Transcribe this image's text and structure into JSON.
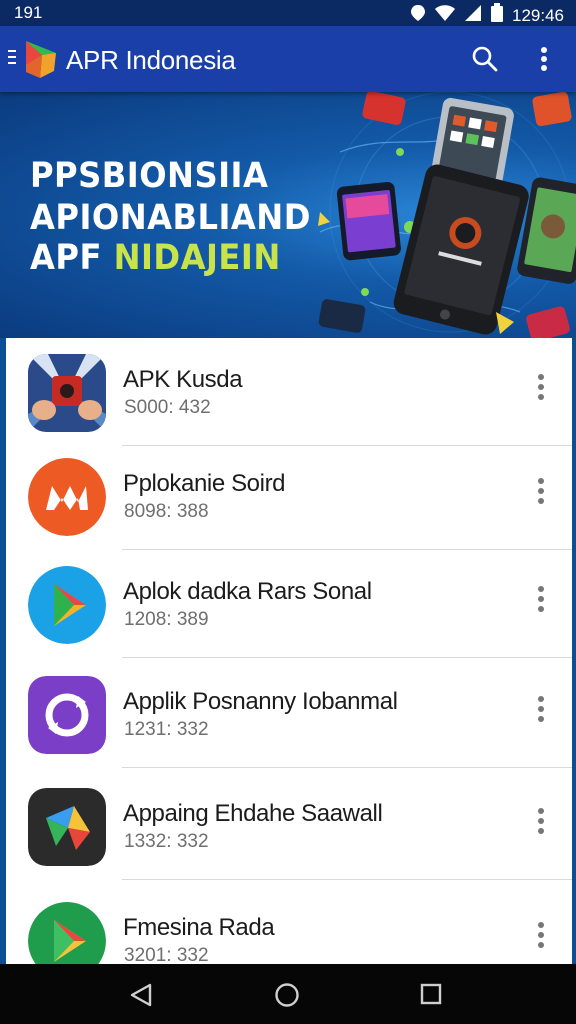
{
  "status_bar": {
    "left_time": "191",
    "right_time": "129:46",
    "icons": [
      "wifi-icon",
      "signal-icon",
      "battery-icon"
    ]
  },
  "app_bar": {
    "title": "APR Indonesia",
    "icons": [
      "menu-icon",
      "app-logo",
      "search-icon",
      "overflow-menu-icon"
    ],
    "background_color": "#1a3fa8"
  },
  "banner": {
    "line1": "PPSBIONSIIA",
    "line2": "APIONABLIAND",
    "line3_prefix": "APF ",
    "line3_accent": "NIDAJEIN",
    "accent_color": "#c9e34a"
  },
  "apps": [
    {
      "name": "APK Kusda",
      "meta": "S000: 432",
      "icon": "game-hands-icon"
    },
    {
      "name": "Pplokanie Soird",
      "meta": "8098: 388",
      "icon": "m-logo-icon"
    },
    {
      "name": "Aplok dadka Rars Sonal",
      "meta": "1208: 389",
      "icon": "play-store-icon"
    },
    {
      "name": "Applik Posnanny Iobanmal",
      "meta": "1231: 332",
      "icon": "purple-swirl-icon"
    },
    {
      "name": "Appaing Ehdahe Saawall",
      "meta": "1332: 332",
      "icon": "colorful-arrow-icon"
    },
    {
      "name": "Fmesina Rada",
      "meta": "3201: 332",
      "icon": "play-store-green-icon"
    }
  ],
  "nav_bar": {
    "icons": [
      "back-icon",
      "home-icon",
      "recents-icon"
    ]
  }
}
